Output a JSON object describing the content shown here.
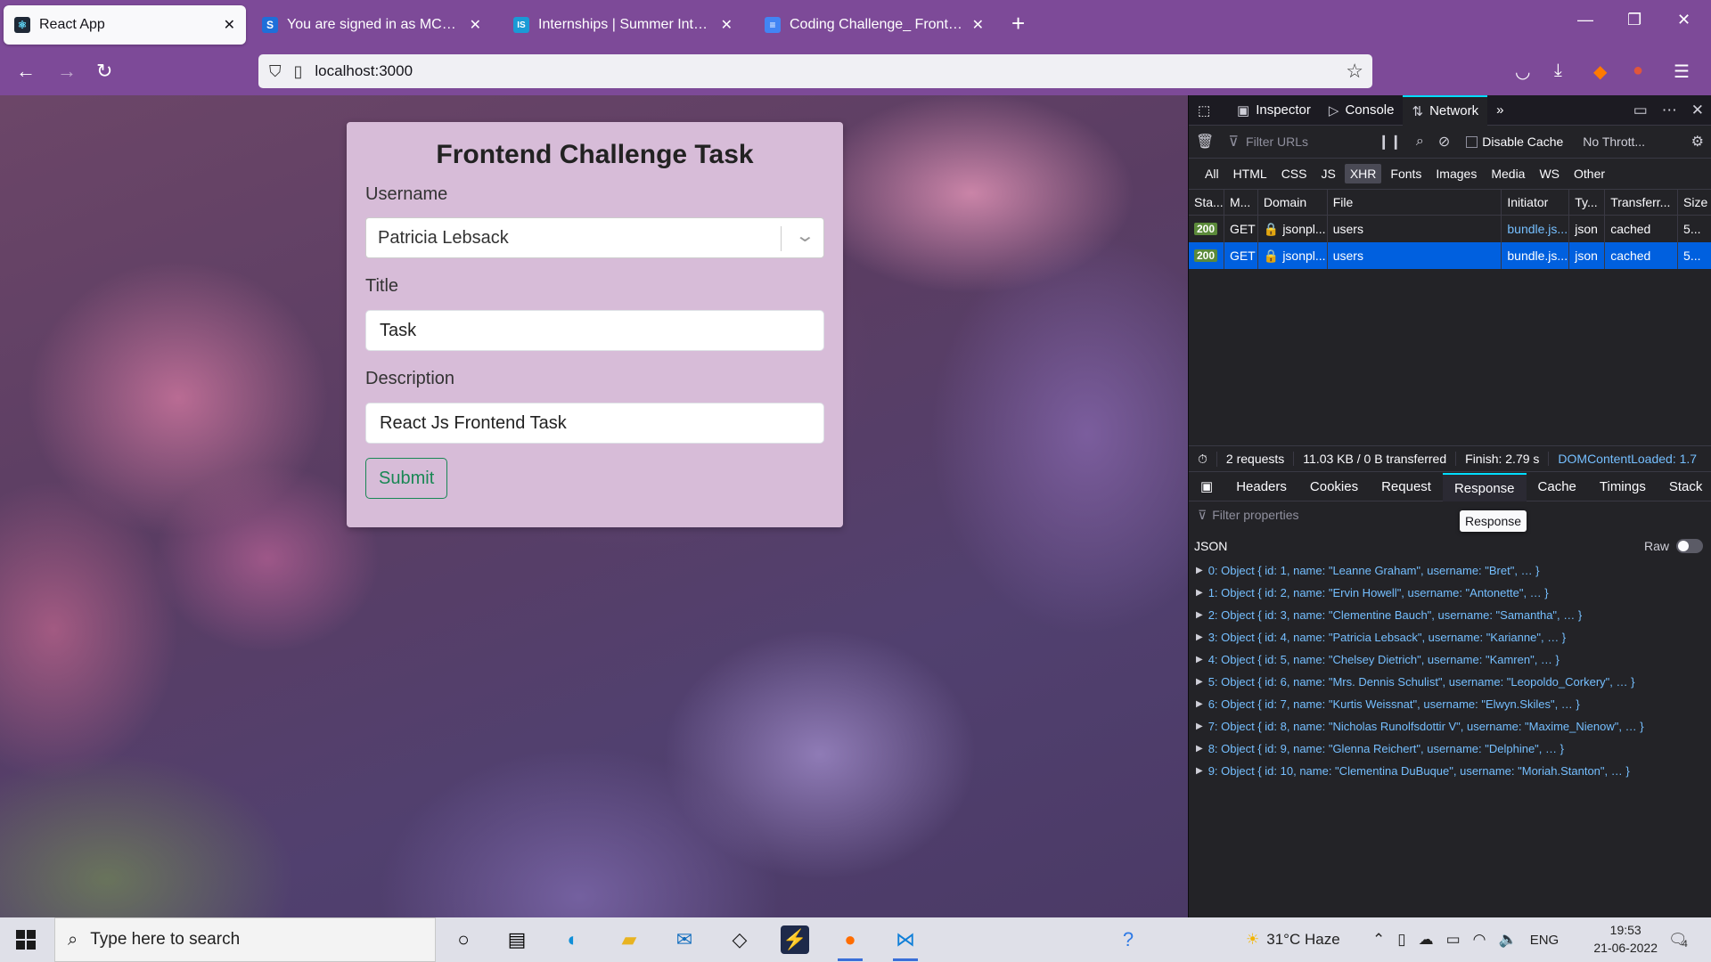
{
  "browser": {
    "tabs": [
      {
        "label": "React App",
        "icon": "react-icon",
        "active": true
      },
      {
        "label": "You are signed in as MCA20211",
        "icon": "s-icon"
      },
      {
        "label": "Internships | Summer Internship",
        "icon": "is-icon"
      },
      {
        "label": "Coding Challenge_ Front-End -",
        "icon": "docs-icon"
      }
    ],
    "url": "localhost:3000"
  },
  "form": {
    "title": "Frontend Challenge Task",
    "username_label": "Username",
    "username_value": "Patricia Lebsack",
    "title_label": "Title",
    "title_value": "Task",
    "description_label": "Description",
    "description_value": "React Js Frontend Task",
    "submit_label": "Submit"
  },
  "devtools": {
    "tabs": [
      "Inspector",
      "Console",
      "Network"
    ],
    "selected_tab": "Network",
    "filter_placeholder": "Filter URLs",
    "disable_cache": "Disable Cache",
    "throttle": "No Thrott...",
    "type_filters": [
      "All",
      "HTML",
      "CSS",
      "JS",
      "XHR",
      "Fonts",
      "Images",
      "Media",
      "WS",
      "Other"
    ],
    "selected_type": "XHR",
    "columns": [
      "Sta...",
      "M...",
      "Domain",
      "File",
      "Initiator",
      "Ty...",
      "Transferr...",
      "Size"
    ],
    "requests": [
      {
        "status": "200",
        "method": "GET",
        "domain": "jsonpl...",
        "file": "users",
        "initiator": "bundle.js...",
        "type": "json",
        "transferred": "cached",
        "size": "5..."
      },
      {
        "status": "200",
        "method": "GET",
        "domain": "jsonpl...",
        "file": "users",
        "initiator": "bundle.js...",
        "type": "json",
        "transferred": "cached",
        "size": "5..."
      }
    ],
    "summary": {
      "requests": "2 requests",
      "size": "11.03 KB / 0 B transferred",
      "finish": "Finish: 2.79 s",
      "dom": "DOMContentLoaded: 1.7"
    },
    "detail_tabs": [
      "Headers",
      "Cookies",
      "Request",
      "Response",
      "Cache",
      "Timings",
      "Stack"
    ],
    "selected_detail": "Response",
    "filter_properties": "Filter properties",
    "tooltip": "Response",
    "json_label": "JSON",
    "raw_label": "Raw",
    "json_rows": [
      "0: Object { id: 1, name: \"Leanne Graham\", username: \"Bret\", … }",
      "1: Object { id: 2, name: \"Ervin Howell\", username: \"Antonette\", … }",
      "2: Object { id: 3, name: \"Clementine Bauch\", username: \"Samantha\", … }",
      "3: Object { id: 4, name: \"Patricia Lebsack\", username: \"Karianne\", … }",
      "4: Object { id: 5, name: \"Chelsey Dietrich\", username: \"Kamren\", … }",
      "5: Object { id: 6, name: \"Mrs. Dennis Schulist\", username: \"Leopoldo_Corkery\", … }",
      "6: Object { id: 7, name: \"Kurtis Weissnat\", username: \"Elwyn.Skiles\", … }",
      "7: Object { id: 8, name: \"Nicholas Runolfsdottir V\", username: \"Maxime_Nienow\", … }",
      "8: Object { id: 9, name: \"Glenna Reichert\", username: \"Delphine\", … }",
      "9: Object { id: 10, name: \"Clementina DuBuque\", username: \"Moriah.Stanton\", … }"
    ]
  },
  "taskbar": {
    "search_placeholder": "Type here to search",
    "weather": "31°C  Haze",
    "lang": "ENG",
    "time": "19:53",
    "date": "21-06-2022",
    "notifications": "4"
  },
  "colors": {
    "browser_chrome": "#7d4a98",
    "card_bg": "#d7bcd8",
    "submit_green": "#198754",
    "devtools_bg": "#232327",
    "selected_row": "#0060df"
  }
}
